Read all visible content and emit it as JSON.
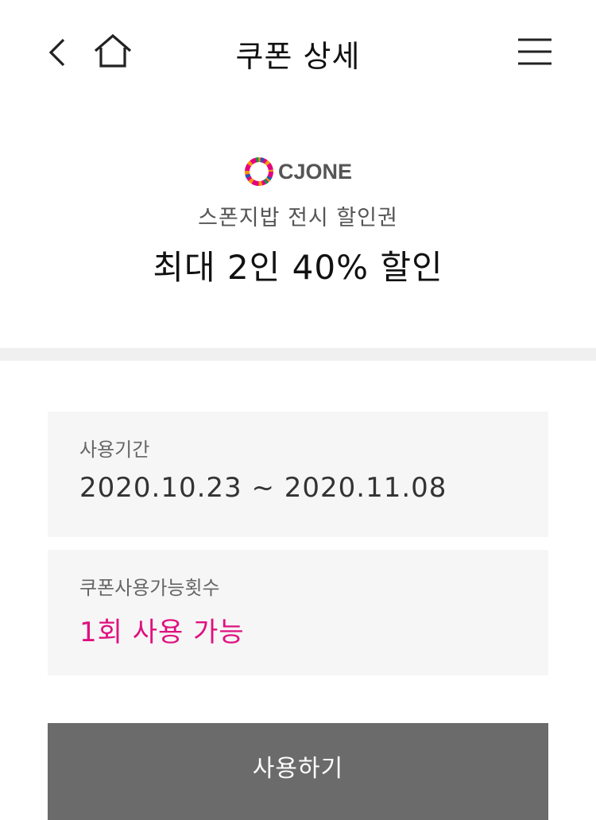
{
  "header": {
    "title": "쿠폰 상세",
    "back_icon": "chevron-left-icon",
    "home_icon": "home-icon",
    "menu_icon": "hamburger-menu-icon"
  },
  "coupon": {
    "brand": "CJONE",
    "subtitle": "스폰지밥 전시 할인권",
    "title": "최대 2인 40% 할인"
  },
  "period": {
    "label": "사용기간",
    "value": "2020.10.23 ~ 2020.11.08"
  },
  "usage": {
    "label": "쿠폰사용가능횟수",
    "value": "1회 사용 가능",
    "accent_color": "#e0107f"
  },
  "actions": {
    "use_label": "사용하기"
  },
  "colors": {
    "button_bg": "#6b6b6b",
    "box_bg": "#f6f6f6",
    "divider": "#f0f0f0"
  }
}
